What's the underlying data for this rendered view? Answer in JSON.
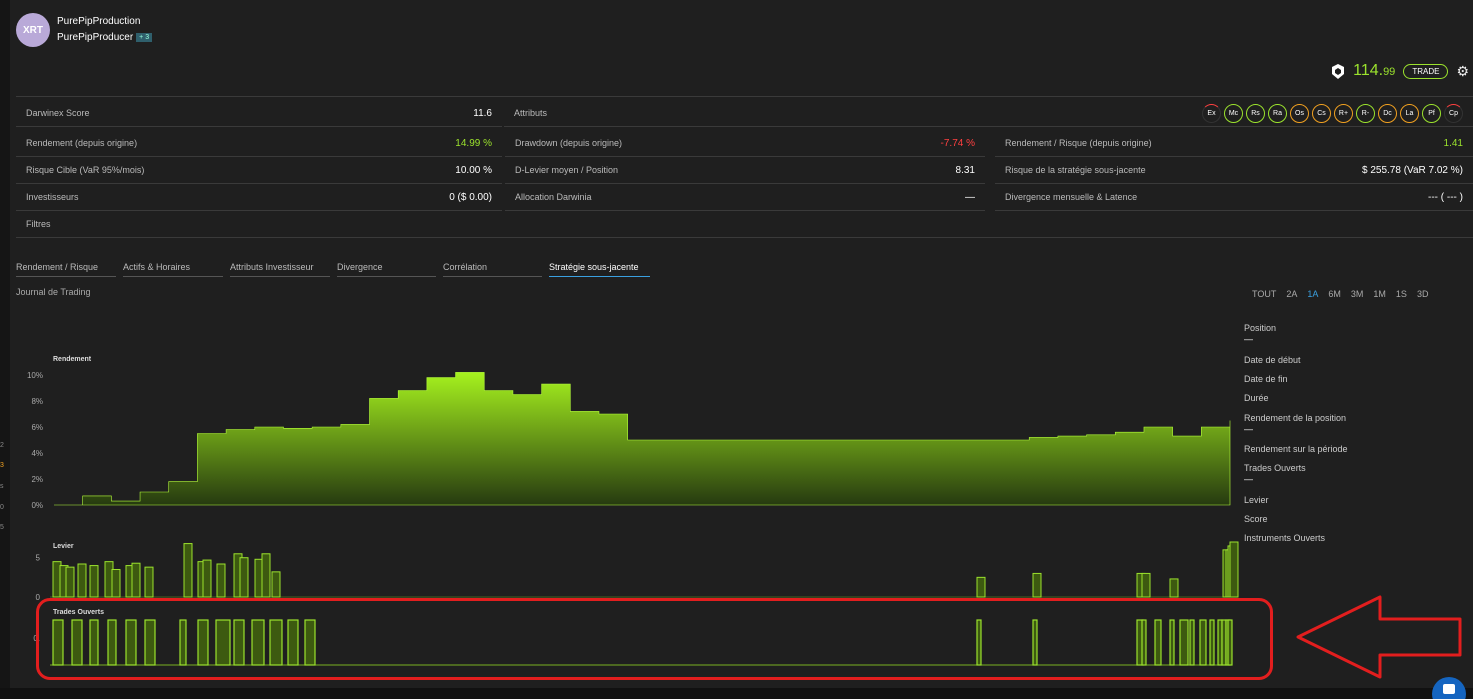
{
  "header": {
    "avatar_text": "XRT",
    "darwin_name": "PurePipProduction",
    "trader_name": "PurePipProducer",
    "trader_badge": "+ 3",
    "price_main": "114.",
    "price_cents": "99",
    "trade_label": "TRADE"
  },
  "metrics": {
    "score_label": "Darwinex Score",
    "score_value": "11.6",
    "attributes_label": "Attributs",
    "attributes": [
      "Ex",
      "Mc",
      "Rs",
      "Ra",
      "Os",
      "Cs",
      "R+",
      "R-",
      "Dc",
      "La",
      "Pf",
      "Cp"
    ],
    "return_label": "Rendement (depuis origine)",
    "return_value": "14.99 %",
    "drawdown_label": "Drawdown (depuis origine)",
    "drawdown_value": "-7.74 %",
    "ret_risk_label": "Rendement / Risque (depuis origine)",
    "ret_risk_value": "1.41",
    "target_risk_label": "Risque Cible (VaR 95%/mois)",
    "target_risk_value": "10.00 %",
    "leverage_label": "D-Levier moyen / Position",
    "leverage_value": "8.31",
    "strategy_risk_label": "Risque de la stratégie sous-jacente",
    "strategy_risk_value": "$ 255.78 (VaR 7.02 %)",
    "investors_label": "Investisseurs",
    "investors_value": "0 ($ 0.00)",
    "allocation_label": "Allocation Darwinia",
    "allocation_value": "—",
    "divergence_label": "Divergence mensuelle & Latence",
    "divergence_value": "--- ( --- )",
    "filters_label": "Filtres"
  },
  "tabs": [
    "Rendement / Risque",
    "Actifs & Horaires",
    "Attributs Investisseur",
    "Divergence",
    "Corrélation",
    "Stratégie sous-jacente"
  ],
  "journal_label": "Journal de Trading",
  "periods": [
    "TOUT",
    "2A",
    "1A",
    "6M",
    "3M",
    "1M",
    "1S",
    "3D"
  ],
  "side_info": {
    "position": "Position",
    "position_value": "—",
    "start": "Date de début",
    "end": "Date de fin",
    "duration": "Durée",
    "pos_return": "Rendement de la position",
    "pos_return_value": "—",
    "period_return": "Rendement sur la période",
    "open_trades": "Trades Ouverts",
    "open_trades_value": "—",
    "leverage": "Levier",
    "score": "Score",
    "instruments": "Instruments Ouverts"
  },
  "colors": {
    "accent": "#9be22d",
    "negative": "#ff4040",
    "highlight": "#e21e1e",
    "link": "#3aa0e0"
  },
  "chart_data": [
    {
      "type": "area",
      "title": "Rendement",
      "y_ticks": [
        "0%",
        "2%",
        "4%",
        "6%",
        "8%",
        "10%"
      ],
      "ylim": [
        0,
        11
      ],
      "values": [
        0,
        0.7,
        0.3,
        1.0,
        1.8,
        5.5,
        5.8,
        6.0,
        5.9,
        6.0,
        6.2,
        8.2,
        8.8,
        9.8,
        10.2,
        8.8,
        8.5,
        9.3,
        7.2,
        7.0,
        5.0,
        5.0,
        5.0,
        5.0,
        5.0,
        5.0,
        5.0,
        5.0,
        5.0,
        5.0,
        5.0,
        5.0,
        5.0,
        5.0,
        5.2,
        5.3,
        5.4,
        5.6,
        6.0,
        5.3,
        6.0,
        6.5
      ]
    },
    {
      "type": "bar",
      "title": "Levier",
      "y_ticks": [
        "0",
        "5"
      ],
      "ylim": [
        0,
        7
      ],
      "values": [
        4.5,
        4.0,
        3.8,
        4.2,
        4.0,
        4.5,
        3.5,
        4.0,
        4.3,
        3.8,
        6.8,
        4.5,
        4.7,
        4.2,
        5.5,
        5.0,
        4.8,
        5.5,
        3.2,
        2.5,
        3.0,
        3.0,
        3.0,
        2.3,
        6.0,
        6.0,
        6.5,
        7.0
      ]
    },
    {
      "type": "bar",
      "title": "Trades Ouverts",
      "y_ticks": [
        "0."
      ],
      "ylim": [
        0,
        1
      ],
      "values": [
        1,
        1,
        1,
        1,
        1,
        1,
        1,
        1,
        1,
        1,
        1,
        1,
        1,
        1,
        1,
        1,
        1,
        1,
        1,
        1,
        1,
        1,
        1,
        1,
        1,
        1,
        1,
        1
      ]
    }
  ]
}
